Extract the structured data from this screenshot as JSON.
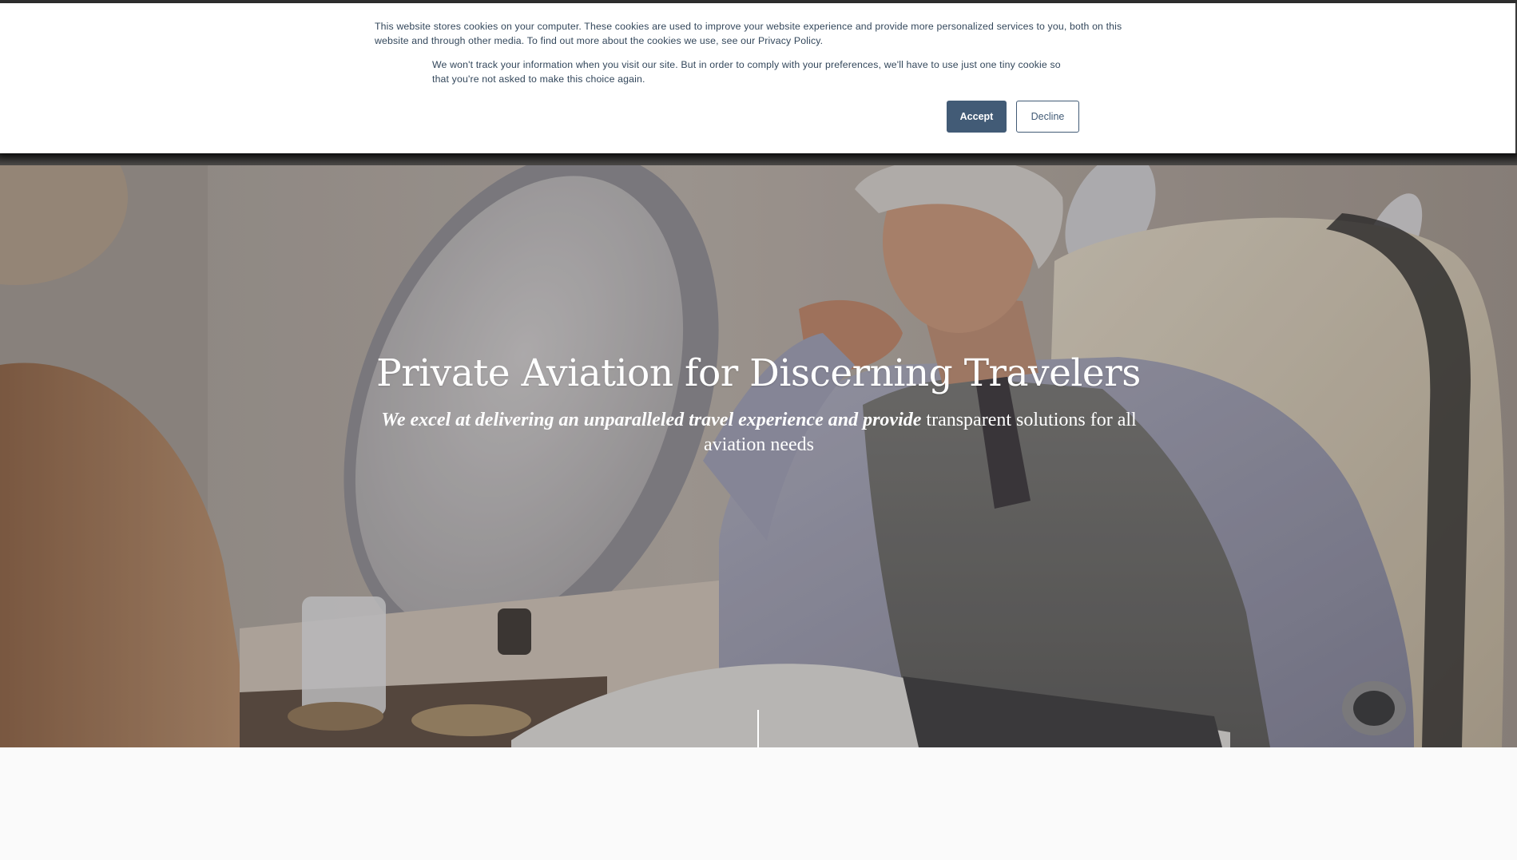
{
  "cookie_banner": {
    "message": "This website stores cookies on your computer. These cookies are used to improve your website experience and provide more personalized services to you, both on this website and through other media. To find out more about the cookies we use, see our Privacy Policy.",
    "decline_notice": "We won't track your information when you visit our site. But in order to comply with your preferences, we'll have to use just one tiny cookie so that you're not asked to make this choice again.",
    "accept_label": "Accept",
    "decline_label": "Decline",
    "accent_color": "#425b76"
  },
  "hero": {
    "title": "Private Aviation for Discerning Travelers",
    "subtitle_emphasis": "We excel at delivering an unparalleled travel experience and provide",
    "subtitle_rest": " transparent solutions for all aviation needs",
    "background_image": "businessman seated in private jet cabin reading magazine"
  }
}
